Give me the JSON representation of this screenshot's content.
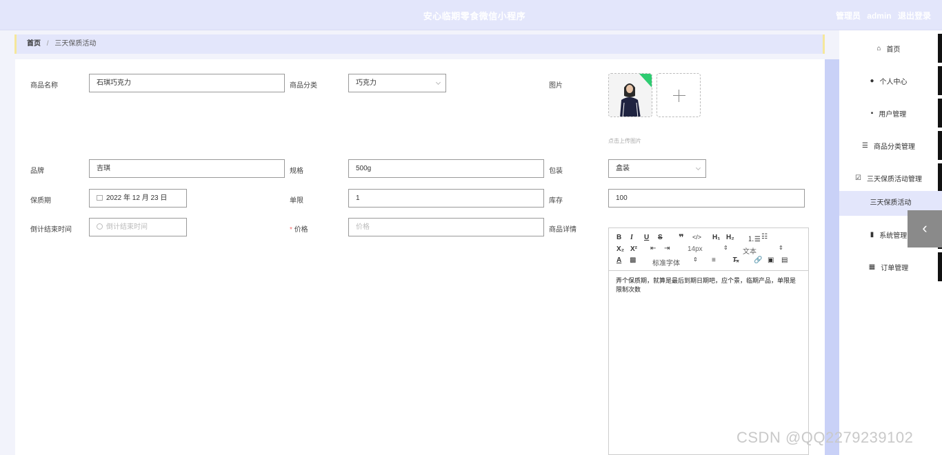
{
  "header": {
    "app_title": "安心临期零食微信小程序",
    "role_label": "管理员",
    "username": "admin",
    "logout_label": "退出登录"
  },
  "breadcrumb": {
    "home": "首页",
    "separator": "/",
    "current": "三天保质活动"
  },
  "form": {
    "product_name": {
      "label": "商品名称",
      "value": "石琪巧克力"
    },
    "category": {
      "label": "商品分类",
      "value": "巧克力"
    },
    "image": {
      "label": "图片",
      "hint": "点击上传图片"
    },
    "brand": {
      "label": "品牌",
      "value": "吉琪"
    },
    "spec": {
      "label": "规格",
      "value": "500g"
    },
    "packaging": {
      "label": "包装",
      "value": "盒装"
    },
    "shelf_life": {
      "label": "保质期",
      "value": "2022 年 12 月 23 日"
    },
    "limit": {
      "label": "单限",
      "value": "1"
    },
    "stock": {
      "label": "库存",
      "value": "100"
    },
    "countdown_end": {
      "label": "倒计结束时间",
      "placeholder": "倒计结束时间"
    },
    "price": {
      "required_mark": "*",
      "label": "价格",
      "placeholder": "价格"
    },
    "details": {
      "label": "商品详情",
      "toolbar": {
        "font_size": "14px",
        "text_type": "文本",
        "font_family": "标准字体"
      },
      "content": "弄个保质期，就算是最后到期日期吧，应个景，临期产品，单限是限制次数"
    }
  },
  "sidebar": {
    "items": [
      {
        "label": "首页",
        "icon": "home-icon"
      },
      {
        "label": "个人中心",
        "icon": "user-icon"
      },
      {
        "label": "用户管理",
        "icon": "chat-icon"
      },
      {
        "label": "商品分类管理",
        "icon": "list-icon"
      },
      {
        "label": "三天保质活动管理",
        "icon": "checkbox-icon"
      },
      {
        "label": "系统管理",
        "icon": "chart-icon"
      },
      {
        "label": "订单管理",
        "icon": "grid-icon"
      }
    ],
    "active_sub": "三天保质活动"
  },
  "watermark": "CSDN @QQ2279239102",
  "colors": {
    "header_bg": "#e3e6fb",
    "accent_border": "#f5e79b",
    "sidebar_active_bg": "#e3e6fb"
  }
}
